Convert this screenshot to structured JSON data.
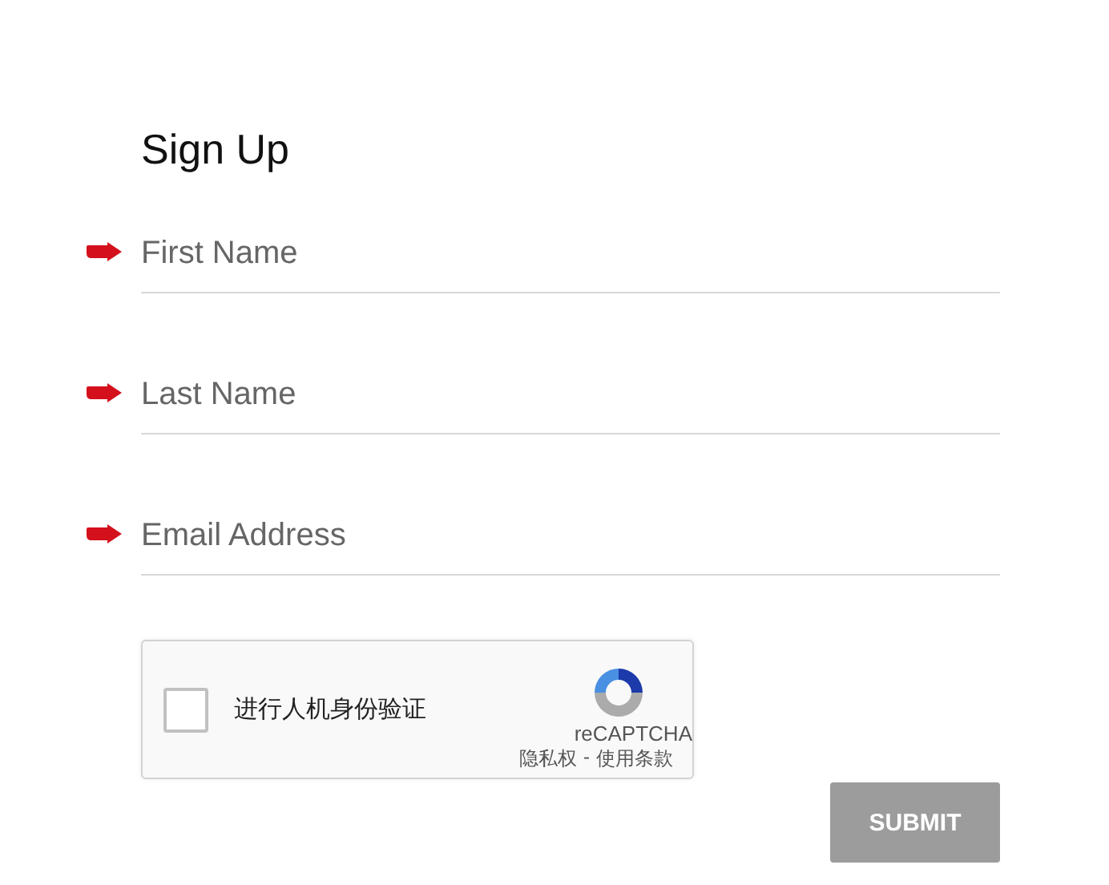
{
  "title": "Sign Up",
  "fields": [
    {
      "placeholder": "First Name",
      "required": true
    },
    {
      "placeholder": "Last Name",
      "required": true
    },
    {
      "placeholder": "Email Address",
      "required": true
    }
  ],
  "captcha": {
    "label": "进行人机身份验证",
    "checked": false,
    "brand": "reCAPTCHA",
    "privacy": "隐私权",
    "separator": "-",
    "terms": "使用条款"
  },
  "submit": {
    "label": "SUBMIT",
    "disabled": true
  }
}
